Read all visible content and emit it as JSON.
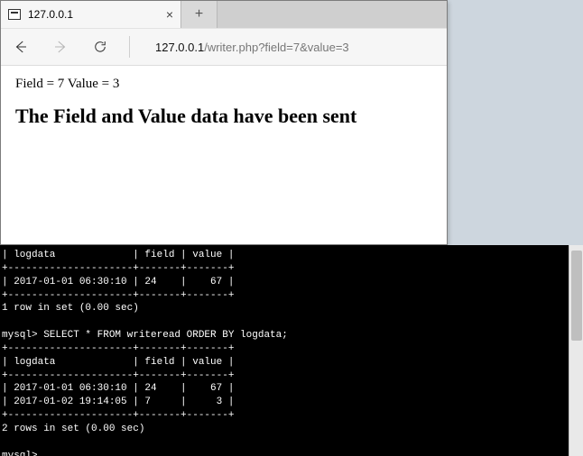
{
  "browser": {
    "tab_title": "127.0.0.1",
    "close_glyph": "×",
    "newtab_glyph": "+",
    "address": {
      "host": "127.0.0.1",
      "path": "/writer.php?field=7&value=3"
    },
    "page": {
      "field_value_line": "Field = 7 Value = 3",
      "headline": "The Field and Value data have been sent"
    }
  },
  "terminal": {
    "lines": [
      "| logdata             | field | value |",
      "+---------------------+-------+-------+",
      "| 2017-01-01 06:30:10 | 24    |    67 |",
      "+---------------------+-------+-------+",
      "1 row in set (0.00 sec)",
      "",
      "mysql> SELECT * FROM writeread ORDER BY logdata;",
      "+---------------------+-------+-------+",
      "| logdata             | field | value |",
      "+---------------------+-------+-------+",
      "| 2017-01-01 06:30:10 | 24    |    67 |",
      "| 2017-01-02 19:14:05 | 7     |     3 |",
      "+---------------------+-------+-------+",
      "2 rows in set (0.00 sec)",
      "",
      "mysql>"
    ]
  }
}
